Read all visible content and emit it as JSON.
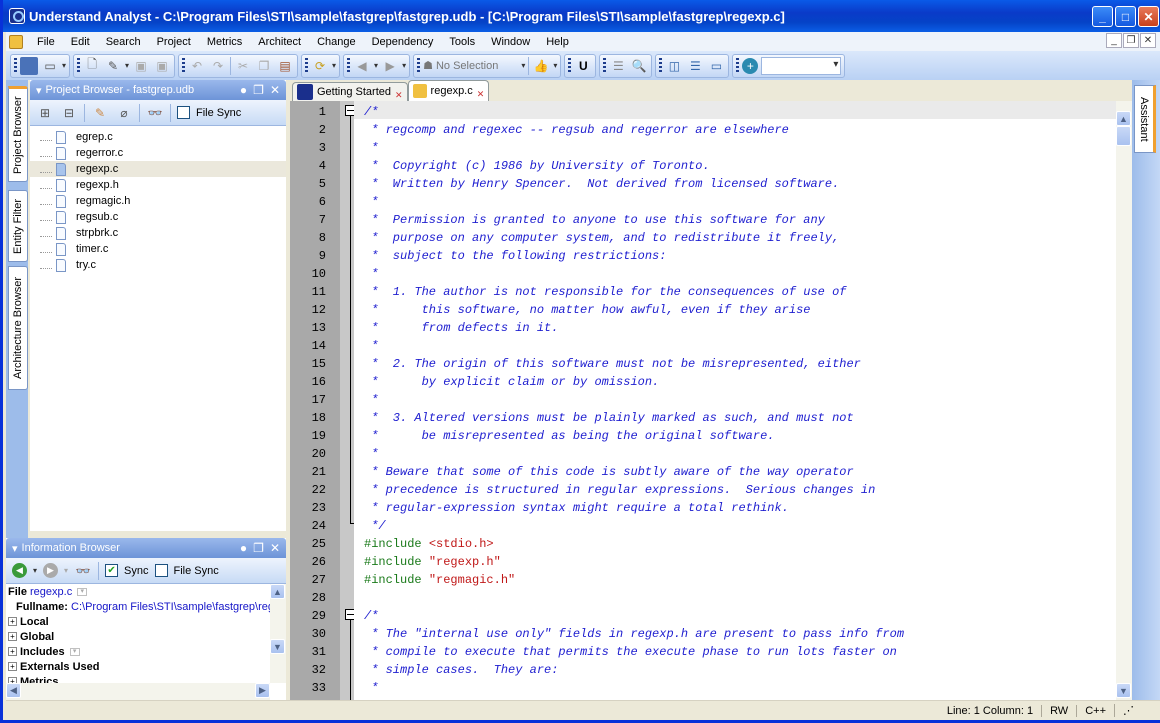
{
  "window": {
    "title": "Understand Analyst - C:\\Program Files\\STI\\sample\\fastgrep\\fastgrep.udb - [C:\\Program Files\\STI\\sample\\fastgrep\\regexp.c]"
  },
  "menu": [
    "File",
    "Edit",
    "Search",
    "Project",
    "Metrics",
    "Architect",
    "Change",
    "Dependency",
    "Tools",
    "Window",
    "Help"
  ],
  "toolbar": {
    "selection_label": "No Selection",
    "combo_value": ""
  },
  "left_tabs": [
    "Project Browser",
    "Entity Filter",
    "Architecture Browser"
  ],
  "project_browser": {
    "title": "Project Browser - fastgrep.udb",
    "file_sync_label": "File Sync",
    "files": [
      "egrep.c",
      "regerror.c",
      "regexp.c",
      "regexp.h",
      "regmagic.h",
      "regsub.c",
      "strpbrk.c",
      "timer.c",
      "try.c"
    ],
    "selected": "regexp.c"
  },
  "info_browser": {
    "title": "Information Browser",
    "sync_label": "Sync",
    "file_sync_label": "File Sync",
    "file_label": "File",
    "file_value": "regexp.c",
    "fullname_label": "Fullname:",
    "fullname_value": "C:\\Program Files\\STI\\sample\\fastgrep\\regexp.c",
    "sections": [
      "Local",
      "Global",
      "Includes",
      "Externals Used",
      "Metrics"
    ]
  },
  "editor": {
    "tabs": [
      {
        "label": "Getting Started"
      },
      {
        "label": "regexp.c",
        "active": true
      }
    ],
    "lines": [
      {
        "n": "1",
        "t": "cm",
        "s": "/*"
      },
      {
        "n": "2",
        "t": "cm",
        "s": " * regcomp and regexec -- regsub and regerror are elsewhere"
      },
      {
        "n": "3",
        "t": "cm",
        "s": " *"
      },
      {
        "n": "4",
        "t": "cm",
        "s": " *  Copyright (c) 1986 by University of Toronto."
      },
      {
        "n": "5",
        "t": "cm",
        "s": " *  Written by Henry Spencer.  Not derived from licensed software."
      },
      {
        "n": "6",
        "t": "cm",
        "s": " *"
      },
      {
        "n": "7",
        "t": "cm",
        "s": " *  Permission is granted to anyone to use this software for any"
      },
      {
        "n": "8",
        "t": "cm",
        "s": " *  purpose on any computer system, and to redistribute it freely,"
      },
      {
        "n": "9",
        "t": "cm",
        "s": " *  subject to the following restrictions:"
      },
      {
        "n": "10",
        "t": "cm",
        "s": " *"
      },
      {
        "n": "11",
        "t": "cm",
        "s": " *  1. The author is not responsible for the consequences of use of"
      },
      {
        "n": "12",
        "t": "cm",
        "s": " *      this software, no matter how awful, even if they arise"
      },
      {
        "n": "13",
        "t": "cm",
        "s": " *      from defects in it."
      },
      {
        "n": "14",
        "t": "cm",
        "s": " *"
      },
      {
        "n": "15",
        "t": "cm",
        "s": " *  2. The origin of this software must not be misrepresented, either"
      },
      {
        "n": "16",
        "t": "cm",
        "s": " *      by explicit claim or by omission."
      },
      {
        "n": "17",
        "t": "cm",
        "s": " *"
      },
      {
        "n": "18",
        "t": "cm",
        "s": " *  3. Altered versions must be plainly marked as such, and must not"
      },
      {
        "n": "19",
        "t": "cm",
        "s": " *      be misrepresented as being the original software."
      },
      {
        "n": "20",
        "t": "cm",
        "s": " *"
      },
      {
        "n": "21",
        "t": "cm",
        "s": " * Beware that some of this code is subtly aware of the way operator"
      },
      {
        "n": "22",
        "t": "cm",
        "s": " * precedence is structured in regular expressions.  Serious changes in"
      },
      {
        "n": "23",
        "t": "cm",
        "s": " * regular-expression syntax might require a total rethink."
      },
      {
        "n": "24",
        "t": "cm",
        "s": " */"
      },
      {
        "n": "25",
        "t": "inc",
        "pp": "#include ",
        "s": "<stdio.h>"
      },
      {
        "n": "26",
        "t": "inc",
        "pp": "#include ",
        "s": "\"regexp.h\""
      },
      {
        "n": "27",
        "t": "inc",
        "pp": "#include ",
        "s": "\"regmagic.h\""
      },
      {
        "n": "28",
        "t": "cm",
        "s": ""
      },
      {
        "n": "29",
        "t": "cm",
        "s": "/*"
      },
      {
        "n": "30",
        "t": "cm",
        "s": " * The \"internal use only\" fields in regexp.h are present to pass info from"
      },
      {
        "n": "31",
        "t": "cm",
        "s": " * compile to execute that permits the execute phase to run lots faster on"
      },
      {
        "n": "32",
        "t": "cm",
        "s": " * simple cases.  They are:"
      },
      {
        "n": "33",
        "t": "cm",
        "s": " *"
      }
    ]
  },
  "right_tabs": [
    "Assistant"
  ],
  "status": {
    "position": "Line: 1  Column: 1",
    "mode": "RW",
    "language": "C++"
  }
}
